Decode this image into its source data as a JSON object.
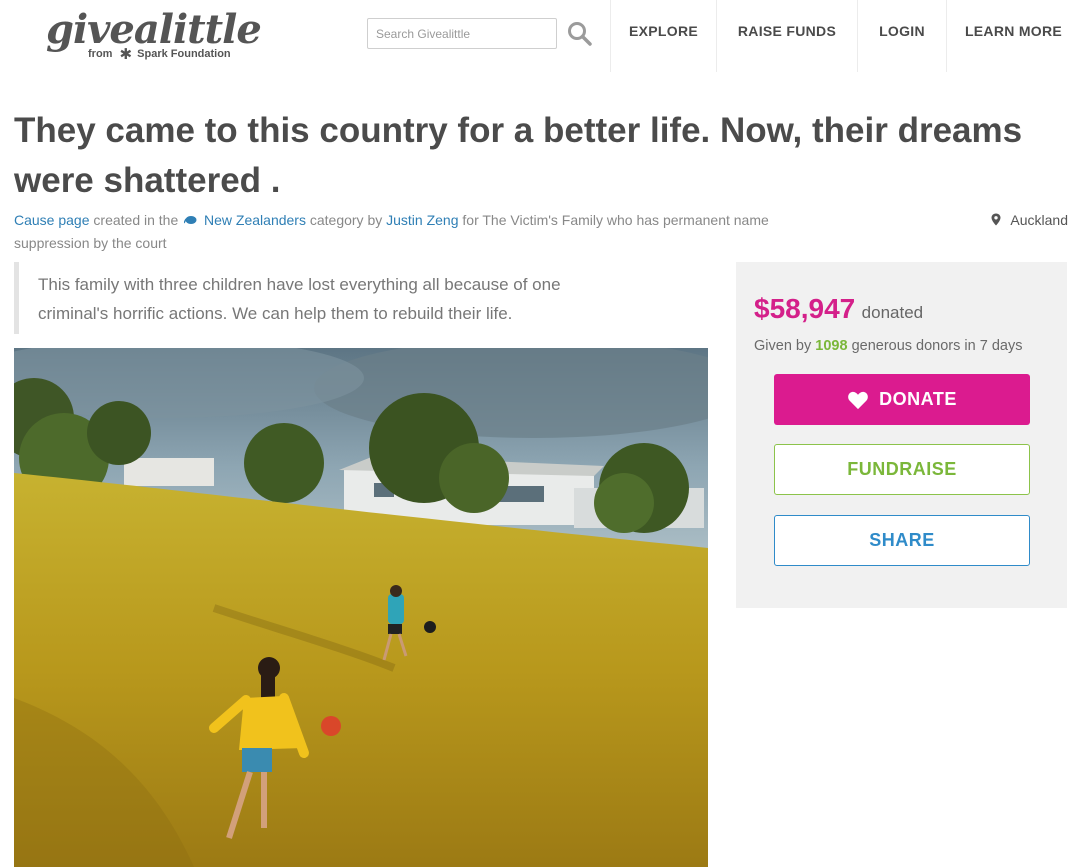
{
  "header": {
    "logo_main": "givealittle",
    "logo_from": "from",
    "logo_org": "Spark Foundation",
    "search_placeholder": "Search Givealittle",
    "nav": [
      "EXPLORE",
      "RAISE FUNDS",
      "LOGIN",
      "LEARN MORE"
    ]
  },
  "page": {
    "title": "They came to this country for a better life. Now, their dreams were shattered .",
    "meta": {
      "cause_page": "Cause page",
      "created_in_the": "created in the",
      "category": "New Zealanders",
      "category_by": "category by",
      "author": "Justin Zeng",
      "for_text": "for The Victim's Family who has permanent name suppression by the court"
    },
    "location": "Auckland",
    "summary": "This family with three children have lost everything all because of one criminal's horrific actions. We can help them to rebuild their life."
  },
  "sidebar": {
    "amount": "$58,947",
    "donated_label": "donated",
    "donors_prefix": "Given by",
    "donor_count": "1098",
    "donors_suffix": "generous donors in 7 days",
    "donate_label": "DONATE",
    "fundraise_label": "FUNDRAISE",
    "share_label": "SHARE"
  },
  "colors": {
    "donate": "#db1b8f",
    "amount": "#d4208a",
    "fundraise": "#7bb73a",
    "share": "#2f8bc9",
    "link": "#2f7fb5"
  }
}
